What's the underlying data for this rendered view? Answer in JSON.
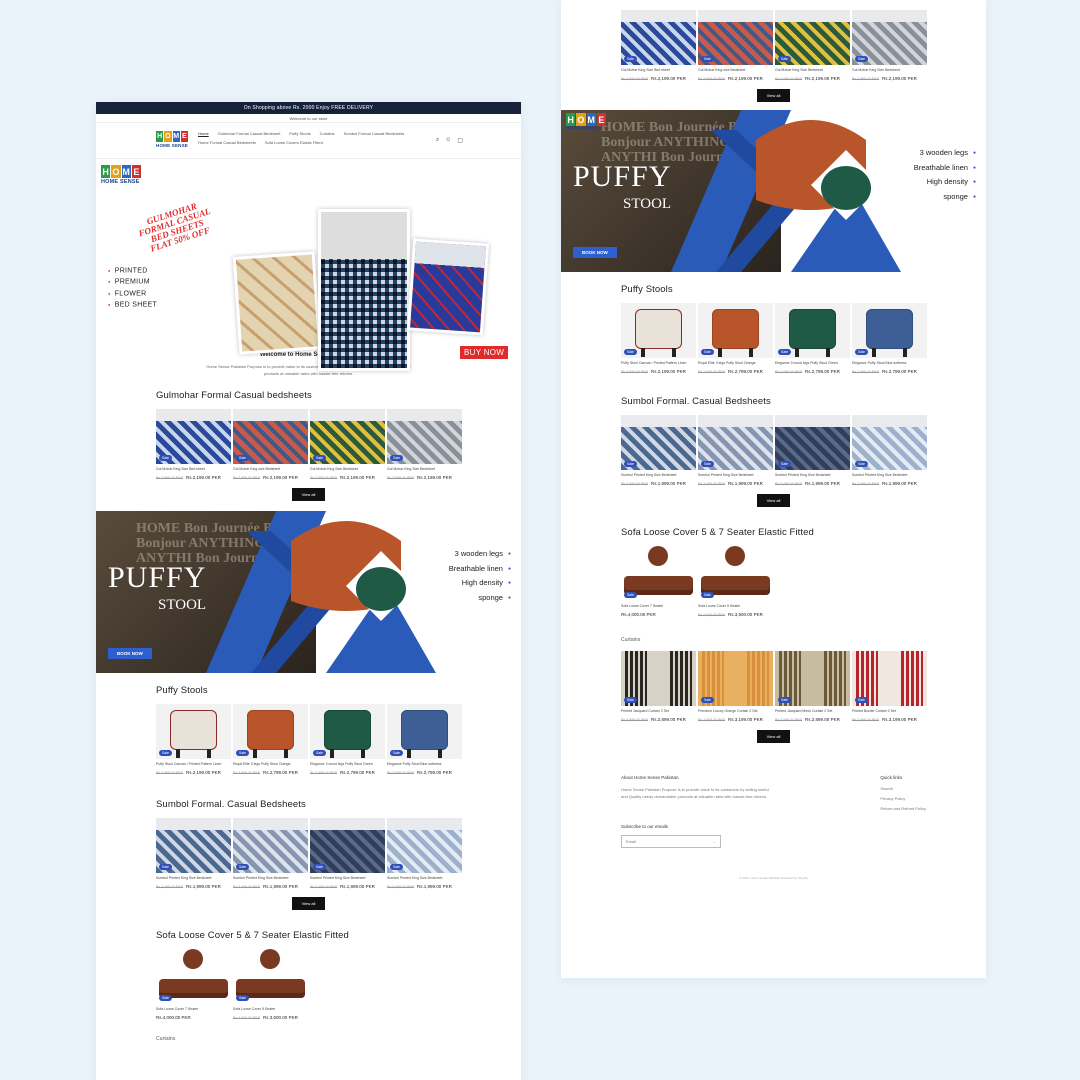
{
  "store": {
    "announcement": "On Shopping above Rs. 2000 Enjoy FREE DELIVERY",
    "welcome_strip": "Welcome to our store",
    "logo_text": "HOME SENSE",
    "nav": [
      "Home",
      "Gulmohar Formal Casual Bedsheet",
      "Puffy Stools",
      "Curtains",
      "Sumbol Formal Casual Bedsheets",
      "Home Formal Casual Bedsheets",
      "Sofa Loose Covers Elastic Fitted"
    ],
    "icons": [
      "search-icon",
      "account-icon",
      "cart-icon"
    ]
  },
  "hero": {
    "promo": "GULMOHAR FORMAL CASUAL BED SHEETS FLAT 50% OFF",
    "bullets": [
      "PRINTED",
      "PREMIUM",
      "FLOWER",
      "BED SHEET"
    ],
    "buy_now": "BUY NOW"
  },
  "intro": {
    "title": "Welcome to Home Sense pakistan",
    "text": "Home Sense Pakistan Purpose is to provide value to its customers by selling useful and Quality needy demandable products at valuable rates with hassle-free returns."
  },
  "banner": {
    "title": "PUFFY",
    "subtitle": "STOOL",
    "button": "BOOK NOW",
    "features": [
      "3 wooden legs",
      "Breathable linen",
      "High density",
      "sponge"
    ],
    "words": "HOME Bon Journée Boo Bonjour ANYTHING Mme ANYTHI Bon Journée"
  },
  "sale_badge": "Sale",
  "view_all": "View all",
  "sections": {
    "gulmohar": {
      "title": "Gulmohar Formal Casual bedsheets",
      "products": [
        {
          "name": "Gul Mohar King Size Bed sheet",
          "old": "Rs.3,899.00 PKR",
          "price": "Rs.2,199.00 PKR",
          "colors": [
            "#2c4a9a",
            "#c8d6ee"
          ]
        },
        {
          "name": "Gul Mohar King size Bedsheet",
          "old": "Rs.3,899.00 PKR",
          "price": "Rs.2,199.00 PKR",
          "colors": [
            "#c85a4a",
            "#3d5a8a"
          ]
        },
        {
          "name": "Gul Mohar King Size Bedsheet",
          "old": "Rs.3,899.00 PKR",
          "price": "Rs.2,199.00 PKR",
          "colors": [
            "#2d5a3a",
            "#e0c040"
          ]
        },
        {
          "name": "Gul Mohar King Size Bedsheet",
          "old": "Rs.3,899.00 PKR",
          "price": "Rs.2,199.00 PKR",
          "colors": [
            "#8a9098",
            "#d2d6dc"
          ]
        }
      ]
    },
    "puffy": {
      "title": "Puffy Stools",
      "products": [
        {
          "name": "Puffy Stool Canvas / Printed Pattern Linen",
          "old": "Rs.3,999.00 PKR",
          "price": "Rs.2,199.00 PKR",
          "colors": [
            "#e8e2d8",
            "#8a2a2a"
          ]
        },
        {
          "name": "Royal Elite 3 legs Puffy Stool Orange",
          "old": "Rs.3,999.00 PKR",
          "price": "Rs.2,799.00 PKR",
          "colors": [
            "#b8552a",
            "#9a4622"
          ]
        },
        {
          "name": "Elegance 3 wood legs Puffy Stool Green",
          "old": "Rs.3,999.00 PKR",
          "price": "Rs.2,799.00 PKR",
          "colors": [
            "#1f5a46",
            "#174838"
          ]
        },
        {
          "name": "Elegance Puffy Stool Blue softness",
          "old": "Rs.3,999.00 PKR",
          "price": "Rs.2,799.00 PKR",
          "colors": [
            "#3d5f96",
            "#304e80"
          ]
        }
      ]
    },
    "sumbol": {
      "title": "Sumbol Formal. Casual Bedsheets",
      "products": [
        {
          "name": "Sumbol Printed King Size Bedsheet",
          "old": "Rs.3,499.00 PKR",
          "price": "Rs.1,999.00 PKR",
          "colors": [
            "#4a6890",
            "#cfd8e4"
          ]
        },
        {
          "name": "Sumbol Printed King Size Bedsheet",
          "old": "Rs.3,499.00 PKR",
          "price": "Rs.1,999.00 PKR",
          "colors": [
            "#8796b0",
            "#dde3ee"
          ]
        },
        {
          "name": "Sumbol Printed King Size Bedsheet",
          "old": "Rs.3,499.00 PKR",
          "price": "Rs.1,999.00 PKR",
          "colors": [
            "#2f3e5a",
            "#5a6a88"
          ]
        },
        {
          "name": "Sumbol Printed King Size Bedsheet",
          "old": "Rs.3,499.00 PKR",
          "price": "Rs.1,999.00 PKR",
          "colors": [
            "#9db0cc",
            "#e4ebf4"
          ]
        }
      ]
    },
    "sofa": {
      "title": "Sofa Loose Cover 5 & 7 Seater Elastic Fitted",
      "products": [
        {
          "name": "Sofa Loose Cover 7 Seater",
          "old": "",
          "price": "Rs.4,000.00 PKR",
          "colors": [
            "#7a3a22",
            "#5a2a18"
          ]
        },
        {
          "name": "Sofa Loose Cover 5 Seater",
          "old": "Rs.4,000.00 PKR",
          "price": "Rs.3,500.00 PKR",
          "colors": [
            "#7a3a22",
            "#5a2a18"
          ]
        }
      ]
    },
    "curtains": {
      "title": "Curtains",
      "products": [
        {
          "name": "Printed Jacquard Curtain 2 Set",
          "old": "Rs.3,999.00 PKR",
          "price": "Rs.2,899.00 PKR",
          "colors": [
            "#2a2622",
            "#d8d2c6"
          ]
        },
        {
          "name": "Premium Luxury Orange Curtain 2 Set",
          "old": "Rs.3,999.00 PKR",
          "price": "Rs.3,199.00 PKR",
          "colors": [
            "#d8903a",
            "#e8b060"
          ]
        },
        {
          "name": "Printed Jacquard Mesh Curtain 2 Set",
          "old": "Rs.3,999.00 PKR",
          "price": "Rs.2,899.00 PKR",
          "colors": [
            "#6a5a3a",
            "#c8bca0"
          ]
        },
        {
          "name": "Printed Border Curtain 2 Set",
          "old": "Rs.3,999.00 PKR",
          "price": "Rs.3,199.00 PKR",
          "colors": [
            "#b8242a",
            "#f0e8e0"
          ]
        }
      ]
    }
  },
  "footer": {
    "about_title": "About Home Sense Pakistan",
    "about_text": "Home Sense Pakistan Purpose is to provide value to its customers by selling useful and Quality needy demandable products at valuable rates with hassle-free returns.",
    "links_title": "Quick links",
    "links": [
      "Search",
      "Privacy Policy",
      "Return and Refund Policy"
    ],
    "subscribe": "Subscribe to our emails",
    "email_placeholder": "Email",
    "copyright": "© 2023, Home Sense Pakistan Powered by Shopify"
  }
}
